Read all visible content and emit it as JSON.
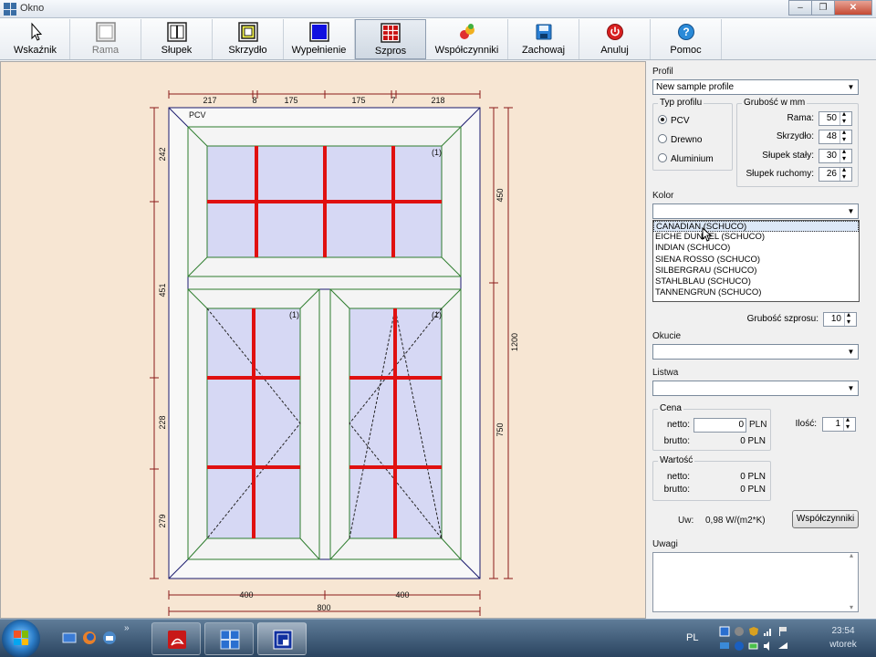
{
  "window": {
    "title": "Okno"
  },
  "toolbar": {
    "items": [
      {
        "label": "Wskaźnik",
        "icon": "pointer-icon"
      },
      {
        "label": "Rama",
        "icon": "frame-icon"
      },
      {
        "label": "Słupek",
        "icon": "mullion-icon"
      },
      {
        "label": "Skrzydło",
        "icon": "sash-icon"
      },
      {
        "label": "Wypełnienie",
        "icon": "fill-icon"
      },
      {
        "label": "Szpros",
        "icon": "muntin-icon"
      },
      {
        "label": "Współczynniki",
        "icon": "coefficients-icon"
      },
      {
        "label": "Zachowaj",
        "icon": "save-icon"
      },
      {
        "label": "Anuluj",
        "icon": "cancel-icon"
      },
      {
        "label": "Pomoc",
        "icon": "help-icon"
      }
    ],
    "active": "Szpros"
  },
  "drawing": {
    "profile_label": "PCV",
    "pane_markers": [
      "(1)",
      "(1)",
      "(1)"
    ],
    "dims_top": [
      "217",
      "8",
      "175",
      "175",
      "7",
      "218"
    ],
    "dims_bottom": [
      "400",
      "400"
    ],
    "dim_total_width": "800",
    "dims_left": [
      "242",
      "451",
      "228",
      "279"
    ],
    "dims_right": [
      "450",
      "750"
    ],
    "dim_total_height": "1200",
    "colors": {
      "frame": "#1a1a6e",
      "sash": "#2e7d2e",
      "glass": "#d6d8f4",
      "muntin": "#e01010",
      "canvas": "#f7e6d3",
      "dim": "#8b1a1a"
    }
  },
  "panel": {
    "profil_label": "Profil",
    "profil_value": "New sample profile",
    "typ_profilu_label": "Typ profilu",
    "typ_profilu_options": [
      "PCV",
      "Drewno",
      "Aluminium"
    ],
    "typ_profilu_selected": "PCV",
    "grubosc_label": "Grubość w mm",
    "grubosc": [
      {
        "label": "Rama:",
        "value": "50"
      },
      {
        "label": "Skrzydło:",
        "value": "48"
      },
      {
        "label": "Słupek stały:",
        "value": "30"
      },
      {
        "label": "Słupek ruchomy:",
        "value": "26"
      }
    ],
    "kolor_label": "Kolor",
    "kolor_value": "",
    "kolor_options": [
      "CANADIAN (SCHUCO)",
      "EICHE DUNKEL (SCHUCO)",
      "INDIAN (SCHUCO)",
      "SIENA ROSSO (SCHUCO)",
      "SILBERGRAU (SCHUCO)",
      "STAHLBLAU (SCHUCO)",
      "TANNENGRUN (SCHUCO)"
    ],
    "kolor_highlighted": "CANADIAN (SCHUCO)",
    "grubosc_szprosu_label": "Grubość szprosu:",
    "grubosc_szprosu_value": "10",
    "okucie_label": "Okucie",
    "okucie_value": "",
    "listwa_label": "Listwa",
    "listwa_value": "",
    "cena": {
      "label": "Cena",
      "netto_label": "netto:",
      "netto_value": "0",
      "netto_currency": "PLN",
      "brutto_label": "brutto:",
      "brutto_value": "0 PLN"
    },
    "ilosc_label": "Ilość:",
    "ilosc_value": "1",
    "wartosc": {
      "label": "Wartość",
      "netto_label": "netto:",
      "netto_value": "0 PLN",
      "brutto_label": "brutto:",
      "brutto_value": "0 PLN"
    },
    "uw_label": "Uw:",
    "uw_value": "0,98 W/(m2*K)",
    "wspolczynniki_button": "Współczynniki",
    "uwagi_label": "Uwagi",
    "uwagi_value": ""
  },
  "taskbar": {
    "language": "PL",
    "time": "23:54",
    "day": "wtorek",
    "apps": [
      "acrobat-icon",
      "window-app-icon",
      "window-designer-icon"
    ]
  }
}
